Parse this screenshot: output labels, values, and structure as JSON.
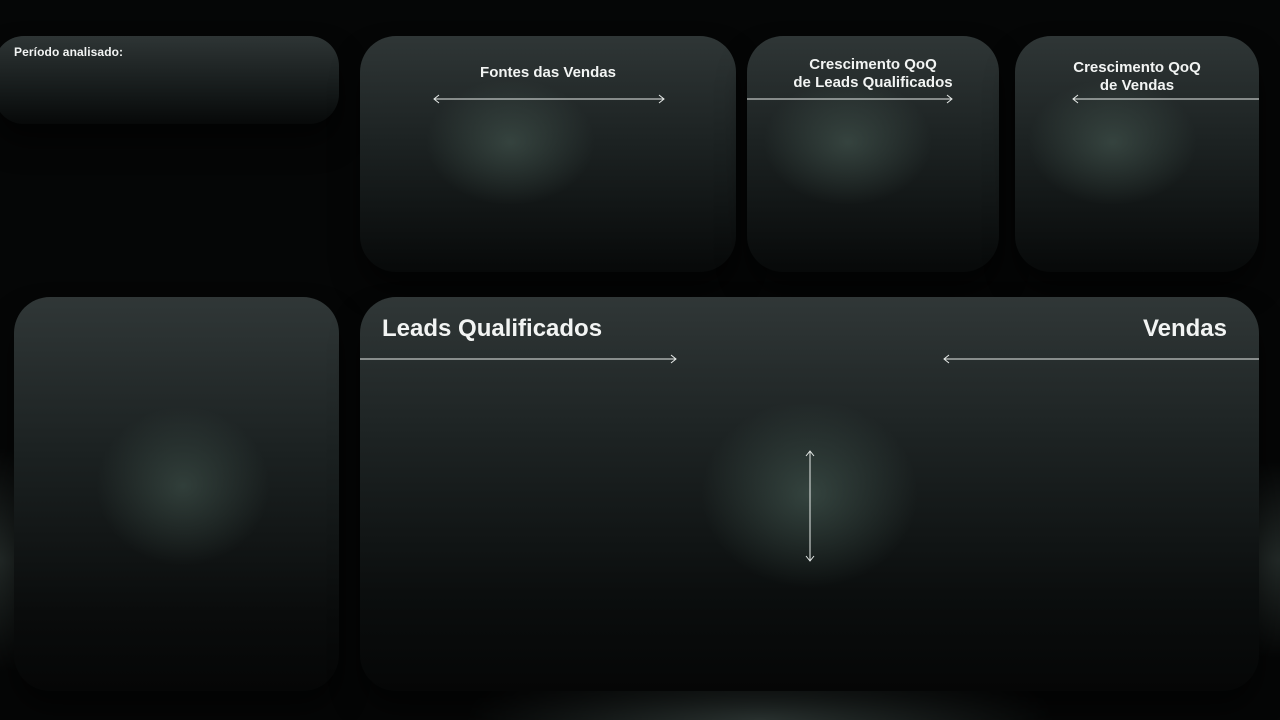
{
  "period": {
    "label": "Período analisado:"
  },
  "cards": {
    "sources": {
      "title": "Fontes das Vendas"
    },
    "qoq_leads": {
      "title": "Crescimento QoQ\nde Leads Qualificados"
    },
    "qoq_sales": {
      "title": "Crescimento QoQ\nde Vendas"
    }
  },
  "main": {
    "left_title": "Leads Qualificados",
    "right_title": "Vendas"
  },
  "icons": {
    "horizontal_double_arrow": "double-arrow-horizontal",
    "right_arrow": "arrow-right",
    "left_arrow": "arrow-left",
    "vertical_double_arrow": "double-arrow-vertical"
  },
  "colors": {
    "background": "#050606",
    "card_top": "#2f3636",
    "text": "#f2f4f3",
    "accent_glow": "#4a5e56"
  }
}
